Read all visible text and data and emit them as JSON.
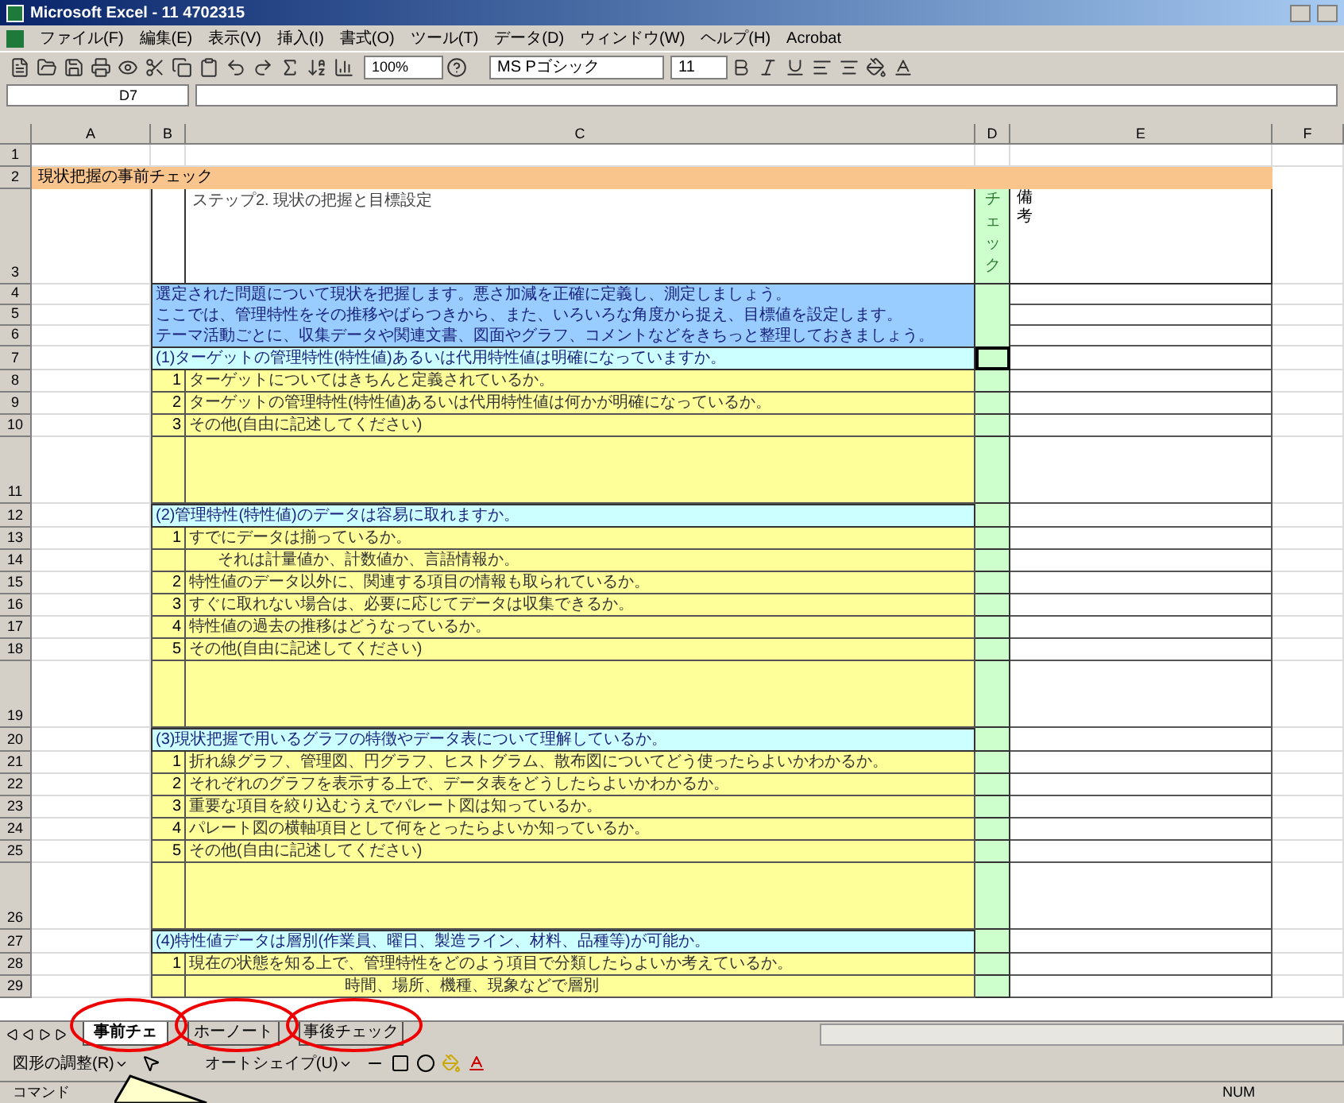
{
  "window": {
    "title": "Microsoft Excel - 11 4702315"
  },
  "menu": [
    "ファイル(F)",
    "編集(E)",
    "表示(V)",
    "挿入(I)",
    "書式(O)",
    "ツール(T)",
    "データ(D)",
    "ウィンドウ(W)",
    "ヘルプ(H)",
    "Acrobat"
  ],
  "toolbar": {
    "zoom": "100%",
    "font": "MS Pゴシック",
    "size": "11"
  },
  "formula_bar": {
    "cell": "D7"
  },
  "columns": [
    "A",
    "B",
    "C",
    "D",
    "E",
    "F"
  ],
  "rows": [
    {
      "n": "1",
      "kind": "blank"
    },
    {
      "n": "2",
      "kind": "title",
      "text": "現状把握の事前チェック"
    },
    {
      "n": "3",
      "kind": "step",
      "text": "ステップ2. 現状の把握と目標設定",
      "check_label": "チェック",
      "remarks_label": "備考"
    },
    {
      "n": "4",
      "kind": "intro",
      "text": "選定された問題について現状を把握します。悪さ加減を正確に定義し、測定しましょう。"
    },
    {
      "n": "5",
      "kind": "intro",
      "text": "ここでは、管理特性をその推移やばらつきから、また、いろいろな角度から捉え、目標値を設定します。"
    },
    {
      "n": "6",
      "kind": "intro",
      "text": "テーマ活動ごとに、収集データや関連文書、図面やグラフ、コメントなどをきちっと整理しておきましょう。"
    },
    {
      "n": "7",
      "kind": "section",
      "text": "(1)ターゲットの管理特性(特性値)あるいは代用特性値は明確になっていますか。"
    },
    {
      "n": "8",
      "kind": "item",
      "no": "1",
      "text": "ターゲットについてはきちんと定義されているか。"
    },
    {
      "n": "9",
      "kind": "item",
      "no": "2",
      "text": "ターゲットの管理特性(特性値)あるいは代用特性値は何かが明確になっているか。"
    },
    {
      "n": "10",
      "kind": "item",
      "no": "3",
      "text": "その他(自由に記述してください)"
    },
    {
      "n": "11",
      "kind": "space"
    },
    {
      "n": "12",
      "kind": "section",
      "text": "(2)管理特性(特性値)のデータは容易に取れますか。"
    },
    {
      "n": "13",
      "kind": "item",
      "no": "1",
      "text": "すでにデータは揃っているか。"
    },
    {
      "n": "14",
      "kind": "sub",
      "text": "それは計量値か、計数値か、言語情報か。"
    },
    {
      "n": "15",
      "kind": "item",
      "no": "2",
      "text": "特性値のデータ以外に、関連する項目の情報も取られているか。"
    },
    {
      "n": "16",
      "kind": "item",
      "no": "3",
      "text": "すぐに取れない場合は、必要に応じてデータは収集できるか。"
    },
    {
      "n": "17",
      "kind": "item",
      "no": "4",
      "text": "特性値の過去の推移はどうなっているか。"
    },
    {
      "n": "18",
      "kind": "item",
      "no": "5",
      "text": "その他(自由に記述してください)"
    },
    {
      "n": "19",
      "kind": "space"
    },
    {
      "n": "20",
      "kind": "section",
      "text": "(3)現状把握で用いるグラフの特徴やデータ表について理解しているか。"
    },
    {
      "n": "21",
      "kind": "item",
      "no": "1",
      "text": "折れ線グラフ、管理図、円グラフ、ヒストグラム、散布図についてどう使ったらよいかわかるか。"
    },
    {
      "n": "22",
      "kind": "item",
      "no": "2",
      "text": "それぞれのグラフを表示する上で、データ表をどうしたらよいかわかるか。"
    },
    {
      "n": "23",
      "kind": "item",
      "no": "3",
      "text": "重要な項目を絞り込むうえでパレート図は知っているか。"
    },
    {
      "n": "24",
      "kind": "item",
      "no": "4",
      "text": "パレート図の横軸項目として何をとったらよいか知っているか。"
    },
    {
      "n": "25",
      "kind": "item",
      "no": "5",
      "text": "その他(自由に記述してください)"
    },
    {
      "n": "26",
      "kind": "space"
    },
    {
      "n": "27",
      "kind": "section",
      "text": "(4)特性値データは層別(作業員、曜日、製造ライン、材料、品種等)が可能か。"
    },
    {
      "n": "28",
      "kind": "item",
      "no": "1",
      "text": "現在の状態を知る上で、管理特性をどのよう項目で分類したらよいか考えているか。"
    },
    {
      "n": "29",
      "kind": "sub",
      "text": "時間、場所、機種、現象などで層別"
    }
  ],
  "sheet_tabs": [
    {
      "label": "事前チェ",
      "selected": true
    },
    {
      "label": "ホーノート",
      "selected": false
    },
    {
      "label": "事後チェック",
      "selected": false
    }
  ],
  "drawing_toolbar": {
    "draw_menu": "図形の調整(R)",
    "autoshape_menu": "オートシェイプ(U)"
  },
  "status_bar": {
    "text": "コマンド",
    "mode": "NUM"
  }
}
